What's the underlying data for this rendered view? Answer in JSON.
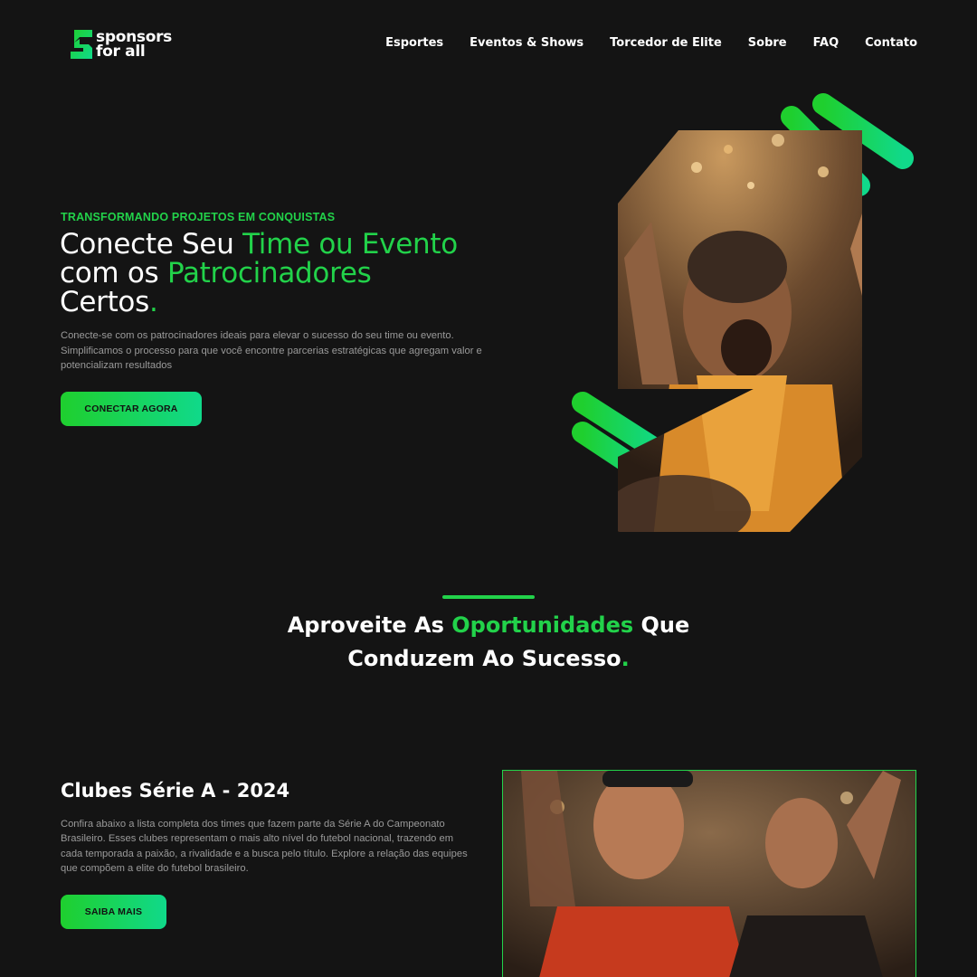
{
  "header": {
    "logo_line1": "sponsors",
    "logo_line2": "for all",
    "nav": [
      "Esportes",
      "Eventos & Shows",
      "Torcedor de Elite",
      "Sobre",
      "FAQ",
      "Contato"
    ]
  },
  "hero": {
    "eyebrow": "TRANSFORMANDO PROJETOS EM CONQUISTAS",
    "title_1": "Conecte Seu ",
    "title_2": "Time ou Evento",
    "title_3": "com os ",
    "title_4": "Patrocinadores",
    "title_5": "Certos",
    "title_dot": ".",
    "description": "Conecte-se com os patrocinadores ideais para elevar o sucesso do seu time ou evento. Simplificamos o processo para que você encontre parcerias estratégicas que agregam valor e potencializam resultados",
    "cta": "CONECTAR AGORA"
  },
  "opportunities": {
    "title_1": "Aproveite As ",
    "title_2": "Oportunidades",
    "title_3": " Que",
    "title_4": "Conduzem Ao Sucesso",
    "title_dot": "."
  },
  "clubs": {
    "title": "Clubes Série A - 2024",
    "description": "Confira abaixo a lista completa dos times que fazem parte da Série A do Campeonato Brasileiro. Esses clubes representam o mais alto nível do futebol nacional, trazendo em cada temporada a paixão, a rivalidade e a busca pelo título. Explore a relação das equipes que compõem a elite do futebol brasileiro.",
    "cta": "SAIBA MAIS"
  },
  "colors": {
    "accent": "#22d24a",
    "accent_teal": "#10d98a",
    "background": "#141414",
    "muted_text": "#9a9a9a"
  }
}
